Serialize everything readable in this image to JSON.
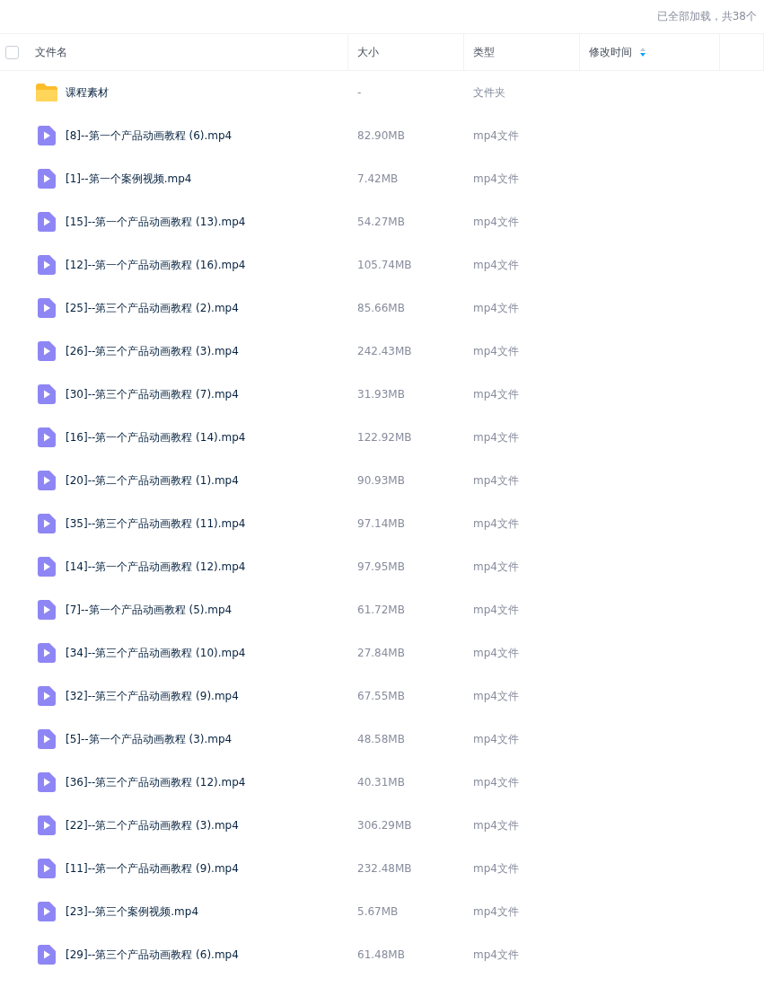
{
  "status": "已全部加载，共38个",
  "select_all": {
    "checked": false
  },
  "columns": [
    {
      "label": "文件名",
      "sorted": false
    },
    {
      "label": "大小",
      "sorted": false
    },
    {
      "label": "类型",
      "sorted": false
    },
    {
      "label": "修改时间",
      "sorted": true
    }
  ],
  "rows": [
    {
      "kind": "folder",
      "name": "课程素材",
      "size": "-",
      "type": "文件夹"
    },
    {
      "kind": "video",
      "name": "[8]--第一个产品动画教程 (6).mp4",
      "size": "82.90MB",
      "type": "mp4文件"
    },
    {
      "kind": "video",
      "name": "[1]--第一个案例视频.mp4",
      "size": "7.42MB",
      "type": "mp4文件"
    },
    {
      "kind": "video",
      "name": "[15]--第一个产品动画教程 (13).mp4",
      "size": "54.27MB",
      "type": "mp4文件"
    },
    {
      "kind": "video",
      "name": "[12]--第一个产品动画教程 (16).mp4",
      "size": "105.74MB",
      "type": "mp4文件"
    },
    {
      "kind": "video",
      "name": "[25]--第三个产品动画教程 (2).mp4",
      "size": "85.66MB",
      "type": "mp4文件"
    },
    {
      "kind": "video",
      "name": "[26]--第三个产品动画教程 (3).mp4",
      "size": "242.43MB",
      "type": "mp4文件"
    },
    {
      "kind": "video",
      "name": "[30]--第三个产品动画教程 (7).mp4",
      "size": "31.93MB",
      "type": "mp4文件"
    },
    {
      "kind": "video",
      "name": "[16]--第一个产品动画教程 (14).mp4",
      "size": "122.92MB",
      "type": "mp4文件"
    },
    {
      "kind": "video",
      "name": "[20]--第二个产品动画教程 (1).mp4",
      "size": "90.93MB",
      "type": "mp4文件"
    },
    {
      "kind": "video",
      "name": "[35]--第三个产品动画教程 (11).mp4",
      "size": "97.14MB",
      "type": "mp4文件"
    },
    {
      "kind": "video",
      "name": "[14]--第一个产品动画教程 (12).mp4",
      "size": "97.95MB",
      "type": "mp4文件"
    },
    {
      "kind": "video",
      "name": "[7]--第一个产品动画教程 (5).mp4",
      "size": "61.72MB",
      "type": "mp4文件"
    },
    {
      "kind": "video",
      "name": "[34]--第三个产品动画教程 (10).mp4",
      "size": "27.84MB",
      "type": "mp4文件"
    },
    {
      "kind": "video",
      "name": "[32]--第三个产品动画教程 (9).mp4",
      "size": "67.55MB",
      "type": "mp4文件"
    },
    {
      "kind": "video",
      "name": "[5]--第一个产品动画教程 (3).mp4",
      "size": "48.58MB",
      "type": "mp4文件"
    },
    {
      "kind": "video",
      "name": "[36]--第三个产品动画教程 (12).mp4",
      "size": "40.31MB",
      "type": "mp4文件"
    },
    {
      "kind": "video",
      "name": "[22]--第二个产品动画教程 (3).mp4",
      "size": "306.29MB",
      "type": "mp4文件"
    },
    {
      "kind": "video",
      "name": "[11]--第一个产品动画教程 (9).mp4",
      "size": "232.48MB",
      "type": "mp4文件"
    },
    {
      "kind": "video",
      "name": "[23]--第三个案例视频.mp4",
      "size": "5.67MB",
      "type": "mp4文件"
    },
    {
      "kind": "video",
      "name": "[29]--第三个产品动画教程 (6).mp4",
      "size": "61.48MB",
      "type": "mp4文件"
    }
  ]
}
